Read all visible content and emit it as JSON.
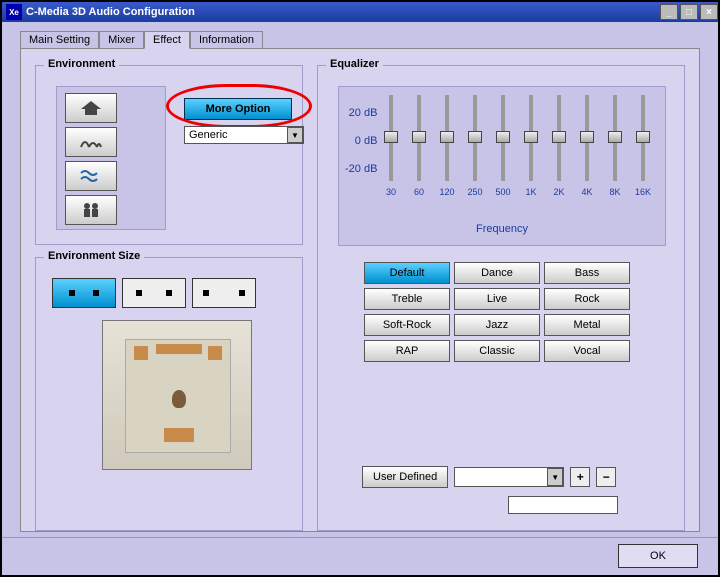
{
  "window": {
    "title": "C-Media 3D Audio Configuration"
  },
  "tabs": [
    "Main Setting",
    "Mixer",
    "Effect",
    "Information"
  ],
  "active_tab": 2,
  "environment": {
    "label": "Environment",
    "more_option": "More Option",
    "selected": "Generic"
  },
  "environment_size": {
    "label": "Environment Size",
    "active": 0
  },
  "equalizer": {
    "label": "Equalizer",
    "db_labels": [
      "20 dB",
      "0 dB",
      "-20 dB"
    ],
    "frequencies": [
      "30",
      "60",
      "120",
      "250",
      "500",
      "1K",
      "2K",
      "4K",
      "8K",
      "16K"
    ],
    "freq_axis": "Frequency",
    "values": [
      0,
      0,
      0,
      0,
      0,
      0,
      0,
      0,
      0,
      0
    ],
    "presets": [
      "Default",
      "Dance",
      "Bass",
      "Treble",
      "Live",
      "Rock",
      "Soft-Rock",
      "Jazz",
      "Metal",
      "RAP",
      "Classic",
      "Vocal"
    ],
    "active_preset": 0,
    "user_defined_label": "User  Defined",
    "plus": "+",
    "minus": "−"
  },
  "ok": "OK",
  "titlebar": {
    "min": "_",
    "max": "□",
    "close": "×"
  }
}
